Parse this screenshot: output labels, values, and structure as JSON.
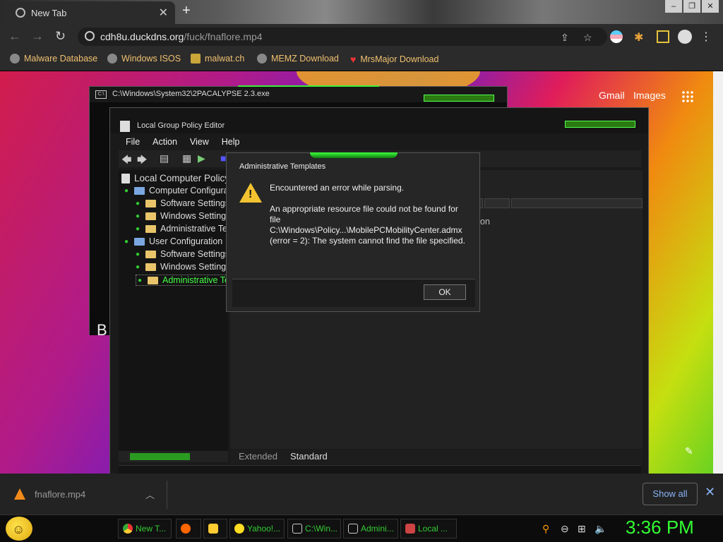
{
  "browser": {
    "tab_title": "New Tab",
    "url_domain": "cdh8u.duckdns.org",
    "url_path": "/fuck/fnaflore.mp4",
    "bookmarks": [
      "Malware Database",
      "Windows ISOS",
      "malwat.ch",
      "MEMZ Download",
      "MrsMajor Download"
    ],
    "ntp_links": [
      "Gmail",
      "Images"
    ]
  },
  "cmd_window": {
    "title": "C:\\Windows\\System32\\2PACALYPSE 2.3.exe",
    "body_text": "B"
  },
  "gpe": {
    "title": "Local Group Policy Editor",
    "menu": [
      "File",
      "Action",
      "View",
      "Help"
    ],
    "tree": [
      "Local Computer Policy",
      "Computer Configuration",
      "Software Settings",
      "Windows Settings",
      "Administrative Templates",
      "User Configuration",
      "Software Settings",
      "Windows Settings",
      "Administrative Templates"
    ],
    "right_fragment": "on",
    "tabs": [
      "Extended",
      "Standard"
    ]
  },
  "dialog": {
    "title": "Administrative Templates",
    "line1": "Encountered an error while parsing.",
    "line2": "An appropriate resource file could not be found for file C:\\Windows\\Policy...\\MobilePCMobilityCenter.admx (error = 2): The system cannot find the file specified.",
    "ok_label": "OK"
  },
  "downloads": {
    "filename": "fnaflore.mp4",
    "show_all": "Show all"
  },
  "taskbar": {
    "buttons": [
      "New T...",
      "",
      "",
      "Yahoo!...",
      "C:\\Win...",
      "Admini...",
      "Local ..."
    ],
    "clock": "3:36 PM"
  },
  "colors": {
    "accent_green": "#33ff33",
    "bookmark_text": "#f0c070",
    "link_blue": "#8ab4f8"
  }
}
